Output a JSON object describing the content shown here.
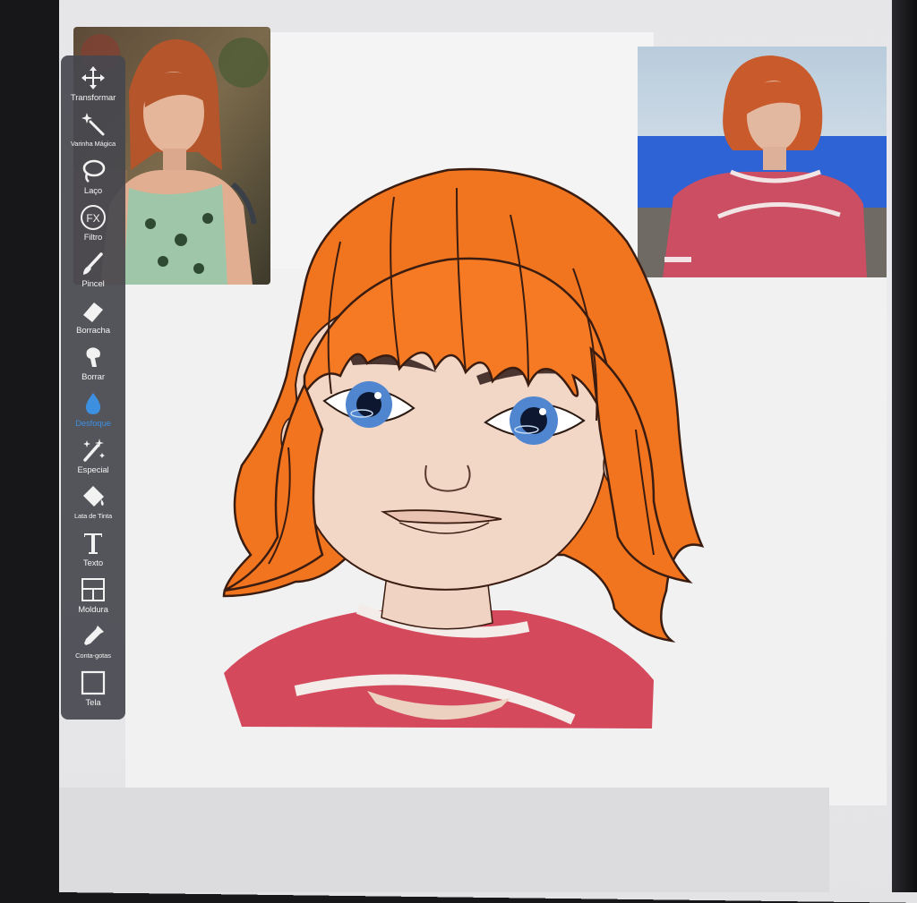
{
  "app": {
    "accent_color": "#3d8fe0",
    "toolbar_bg": "#46484e"
  },
  "toolbar": {
    "tools": [
      {
        "id": "transformar",
        "label": "Transformar",
        "icon": "move-arrows-icon",
        "active": false
      },
      {
        "id": "varinha",
        "label": "Varinha Mágica",
        "icon": "magic-wand-icon",
        "active": false
      },
      {
        "id": "laco",
        "label": "Laço",
        "icon": "lasso-icon",
        "active": false
      },
      {
        "id": "filtro",
        "label": "Filtro",
        "icon": "fx-icon",
        "active": false
      },
      {
        "id": "pincel",
        "label": "Pincel",
        "icon": "brush-icon",
        "active": false
      },
      {
        "id": "borracha",
        "label": "Borracha",
        "icon": "eraser-icon",
        "active": false
      },
      {
        "id": "borrar",
        "label": "Borrar",
        "icon": "smudge-finger-icon",
        "active": false
      },
      {
        "id": "desfoque",
        "label": "Desfoque",
        "icon": "blur-drop-icon",
        "active": true
      },
      {
        "id": "especial",
        "label": "Especial",
        "icon": "sparkle-wand-icon",
        "active": false
      },
      {
        "id": "lata",
        "label": "Lata de Tinta",
        "icon": "paint-bucket-icon",
        "active": false
      },
      {
        "id": "texto",
        "label": "Texto",
        "icon": "text-T-icon",
        "active": false
      },
      {
        "id": "moldura",
        "label": "Moldura",
        "icon": "frame-grid-icon",
        "active": false
      },
      {
        "id": "contagotas",
        "label": "Conta-gotas",
        "icon": "eyedropper-icon",
        "active": false
      },
      {
        "id": "tela",
        "label": "Tela",
        "icon": "canvas-square-icon",
        "active": false
      }
    ]
  },
  "colors": {
    "hair": "#f47a24",
    "skin": "#f0d5c4",
    "shirt": "#d4495c",
    "trim": "#f3ebe8",
    "eyes": "#4f86cf"
  }
}
